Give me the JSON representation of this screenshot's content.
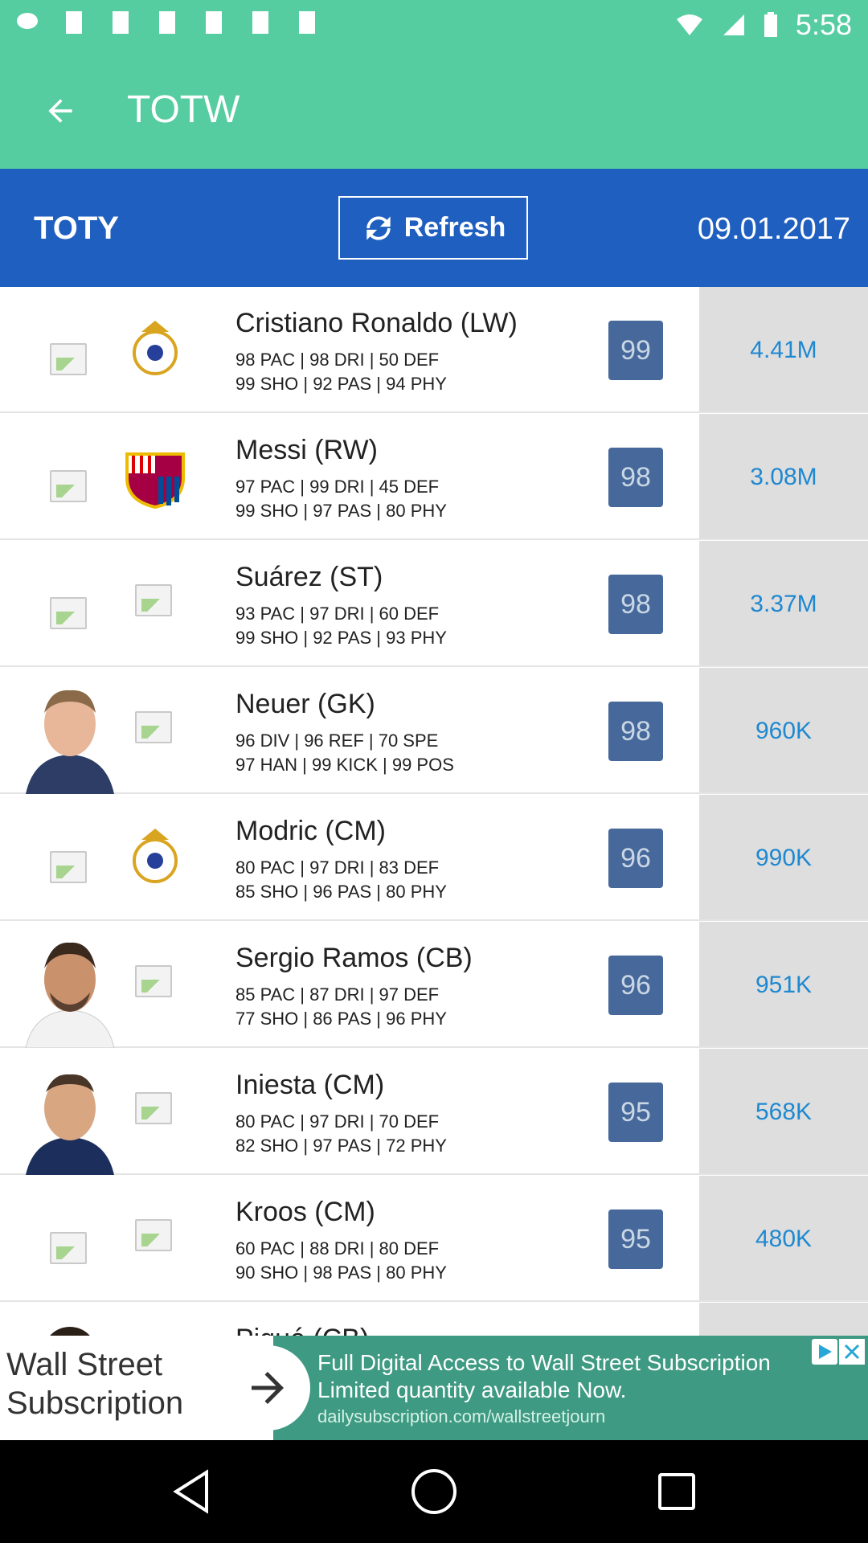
{
  "status": {
    "time": "5:58"
  },
  "appbar": {
    "title": "TOTW"
  },
  "toolbar": {
    "toty": "TOTY",
    "refresh": "Refresh",
    "date": "09.01.2017"
  },
  "players": [
    {
      "name": "Cristiano Ronaldo (LW)",
      "stats1": "98 PAC | 98 DRI | 50 DEF",
      "stats2": "99 SHO | 92 PAS | 94 PHY",
      "rating": "99",
      "price": "4.41M",
      "club_icon": "real-madrid-crest-icon"
    },
    {
      "name": "Messi (RW)",
      "stats1": "97 PAC | 99 DRI | 45 DEF",
      "stats2": "99 SHO | 97 PAS | 80 PHY",
      "rating": "98",
      "price": "3.08M",
      "club_icon": "barcelona-crest-icon"
    },
    {
      "name": "Suárez (ST)",
      "stats1": "93 PAC | 97 DRI | 60 DEF",
      "stats2": "99 SHO | 92 PAS | 93 PHY",
      "rating": "98",
      "price": "3.37M",
      "club_icon": "broken-image-icon"
    },
    {
      "name": "Neuer (GK)",
      "stats1": "96 DIV | 96 REF | 70 SPE",
      "stats2": "97 HAN | 99 KICK | 99 POS",
      "rating": "98",
      "price": "960K",
      "club_icon": "broken-image-icon"
    },
    {
      "name": "Modric (CM)",
      "stats1": "80 PAC | 97 DRI | 83 DEF",
      "stats2": "85 SHO | 96 PAS | 80 PHY",
      "rating": "96",
      "price": "990K",
      "club_icon": "real-madrid-crest-icon"
    },
    {
      "name": "Sergio Ramos (CB)",
      "stats1": "85 PAC | 87 DRI | 97 DEF",
      "stats2": "77 SHO | 86 PAS | 96 PHY",
      "rating": "96",
      "price": "951K",
      "club_icon": "broken-image-icon"
    },
    {
      "name": "Iniesta (CM)",
      "stats1": "80 PAC | 97 DRI | 70 DEF",
      "stats2": "82 SHO | 97 PAS | 72 PHY",
      "rating": "95",
      "price": "568K",
      "club_icon": "broken-image-icon"
    },
    {
      "name": "Kroos (CM)",
      "stats1": "60 PAC | 88 DRI | 80 DEF",
      "stats2": "90 SHO | 98 PAS | 80 PHY",
      "rating": "95",
      "price": "480K",
      "club_icon": "broken-image-icon"
    },
    {
      "name": "Piqué (CB)",
      "stats1": "",
      "stats2": "",
      "rating": "",
      "price": "",
      "club_icon": "barcelona-crest-icon"
    }
  ],
  "ad": {
    "left_text": "Wall Street Subscription",
    "line1": "Full Digital Access to Wall Street Subscription",
    "line2": "Limited quantity available Now.",
    "line3": "dailysubscription.com/wallstreetjourn"
  },
  "colors": {
    "appbar": "#56cca1",
    "toolbar": "#1f5fbf",
    "badge": "#46689a",
    "price": "#1e88d1"
  }
}
